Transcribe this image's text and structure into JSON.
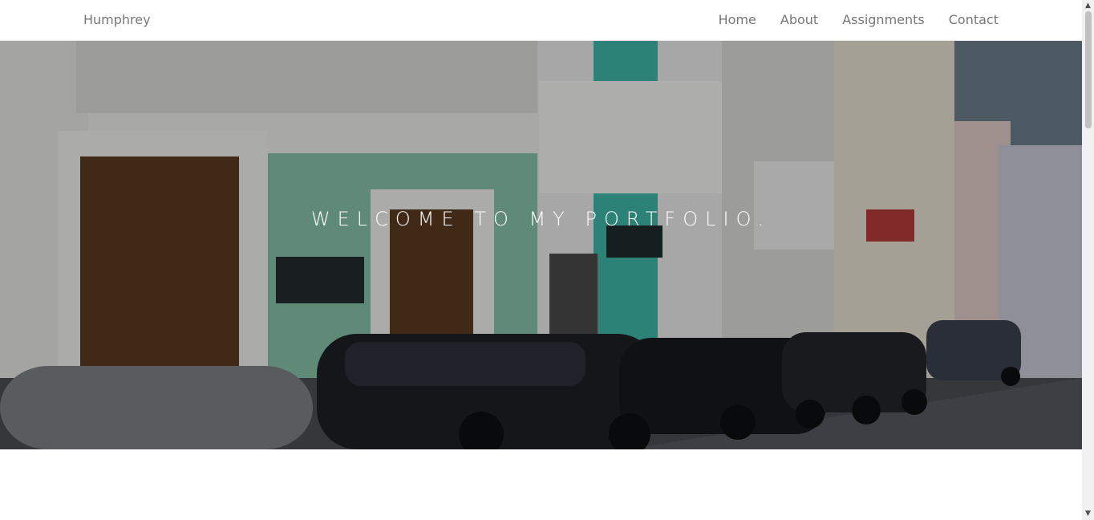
{
  "navbar": {
    "brand": "Humphrey",
    "links": [
      "Home",
      "About",
      "Assignments",
      "Contact"
    ]
  },
  "hero": {
    "title": "Welcome to my portfolio."
  },
  "colors": {
    "nav_text": "#777777",
    "hero_wall_green": "#8cc5ad",
    "hero_overlay": "rgba(0,0,0,0.28)"
  }
}
